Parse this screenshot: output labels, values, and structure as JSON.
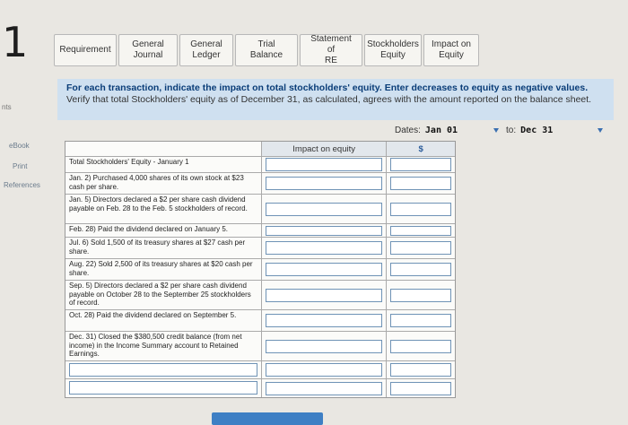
{
  "question_number": "1",
  "side": {
    "points_label": "nts",
    "links": [
      "eBook",
      "Print",
      "References"
    ]
  },
  "tabs": [
    {
      "line1": "Requirement",
      "line2": ""
    },
    {
      "line1": "General",
      "line2": "Journal"
    },
    {
      "line1": "General",
      "line2": "Ledger"
    },
    {
      "line1": "Trial Balance",
      "line2": ""
    },
    {
      "line1": "Statement of",
      "line2": "RE"
    },
    {
      "line1": "Stockholders",
      "line2": "Equity"
    },
    {
      "line1": "Impact on",
      "line2": "Equity"
    }
  ],
  "instructions": {
    "bold": "For each transaction, indicate the impact on total stockholders' equity. Enter decreases to equity as negative values.",
    "normal": " Verify that total Stockholders' equity as of December 31, as calculated, agrees with the amount reported on the balance sheet."
  },
  "dates": {
    "label": "Dates:",
    "from": "Jan 01",
    "to_label": "to:",
    "to": "Dec 31"
  },
  "table": {
    "header_impact": "Impact on equity",
    "header_unit": "$",
    "rows": [
      "Total Stockholders' Equity - January 1",
      "Jan. 2) Purchased 4,000 shares of its own stock at $23 cash per share.",
      "Jan. 5) Directors declared a $2 per share cash dividend payable on Feb. 28 to the Feb. 5 stockholders of record.",
      "Feb. 28) Paid the dividend declared on January 5.",
      "Jul. 6) Sold 1,500 of its treasury shares at $27 cash per share.",
      "Aug. 22) Sold 2,500 of its treasury shares at $20 cash per share.",
      "Sep. 5) Directors declared a $2 per share cash dividend payable on October 28 to the September 25 stockholders of record.",
      "Oct. 28) Paid the dividend declared on September 5.",
      "Dec. 31) Closed the $380,500 credit balance (from net income) in the Income Summary account to Retained Earnings.",
      "",
      ""
    ]
  }
}
